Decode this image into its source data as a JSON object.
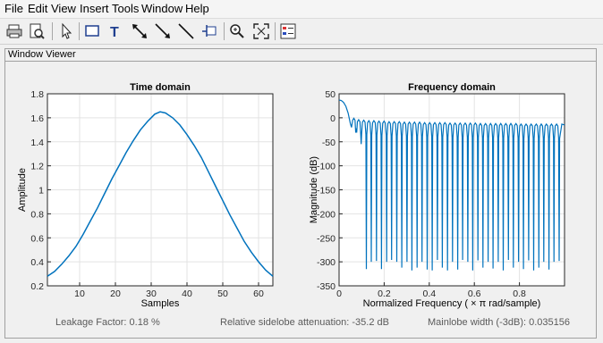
{
  "menu": [
    "File",
    "Edit",
    "View",
    "Insert",
    "Tools",
    "Window",
    "Help"
  ],
  "toolbar": [
    {
      "name": "print-icon"
    },
    {
      "name": "print-preview-icon"
    },
    {
      "name": "edit-plot-arrow-icon"
    },
    {
      "name": "insert-rectangle-icon"
    },
    {
      "name": "insert-text-icon"
    },
    {
      "name": "insert-double-arrow-icon"
    },
    {
      "name": "insert-arrow-icon"
    },
    {
      "name": "insert-line-icon"
    },
    {
      "name": "pin-icon"
    },
    {
      "name": "zoom-in-icon"
    },
    {
      "name": "full-view-icon"
    },
    {
      "name": "legend-icon"
    }
  ],
  "panel": {
    "title": "Window Viewer"
  },
  "stats": {
    "leakage": "Leakage Factor: 0.18 %",
    "sidelobe": "Relative sidelobe attenuation: -35.2 dB",
    "mainlobe": "Mainlobe width (-3dB): 0.035156"
  },
  "colors": {
    "line": "#0072bd",
    "grid": "#e3e3e3"
  },
  "chart_data": [
    {
      "type": "line",
      "title": "Time domain",
      "xlabel": "Samples",
      "ylabel": "Amplitude",
      "xlim": [
        1,
        64
      ],
      "ylim": [
        0.2,
        1.8
      ],
      "xticks": [
        10,
        20,
        30,
        40,
        50,
        60
      ],
      "yticks": [
        0.2,
        0.4,
        0.6,
        0.8,
        1,
        1.2,
        1.4,
        1.6,
        1.8
      ],
      "ytick_labels": [
        "0.2",
        "0.4",
        "0.6",
        "0.8",
        "1",
        "1.2",
        "1.4",
        "1.6",
        "1.8"
      ],
      "grid": true,
      "x": [
        1,
        3,
        5,
        7,
        9,
        11,
        13,
        15,
        17,
        19,
        21,
        23,
        25,
        27,
        29,
        31,
        32.5,
        34,
        36,
        38,
        40,
        42,
        44,
        46,
        48,
        50,
        52,
        54,
        56,
        58,
        60,
        62,
        64
      ],
      "y": [
        0.28,
        0.32,
        0.38,
        0.45,
        0.53,
        0.63,
        0.74,
        0.85,
        0.97,
        1.09,
        1.2,
        1.31,
        1.41,
        1.5,
        1.57,
        1.63,
        1.65,
        1.64,
        1.6,
        1.54,
        1.46,
        1.37,
        1.27,
        1.15,
        1.03,
        0.91,
        0.79,
        0.68,
        0.57,
        0.48,
        0.4,
        0.33,
        0.28
      ]
    },
    {
      "type": "line",
      "title": "Frequency domain",
      "xlabel": "Normalized Frequency  ( × π rad/sample)",
      "ylabel": "Magnitude (dB)",
      "xlim": [
        0,
        1
      ],
      "ylim": [
        -350,
        50
      ],
      "xticks": [
        0,
        0.2,
        0.4,
        0.6,
        0.8
      ],
      "xtick_labels": [
        "0",
        "0.2",
        "0.4",
        "0.6",
        "0.8"
      ],
      "yticks": [
        50,
        0,
        -50,
        -100,
        -150,
        -200,
        -250,
        -300,
        -350
      ],
      "grid": true,
      "mainlobe": {
        "x": [
          0,
          0.01,
          0.02,
          0.03,
          0.04,
          0.05
        ],
        "y": [
          37,
          36,
          32,
          24,
          10,
          -12
        ]
      },
      "first_null": {
        "x": 0.055,
        "y": -20
      },
      "nulls": [
        {
          "x": 0.076,
          "y": -22
        },
        {
          "x": 0.098,
          "y": -55
        },
        {
          "x": 0.121,
          "y": -315
        },
        {
          "x": 0.143,
          "y": -300
        },
        {
          "x": 0.166,
          "y": -298
        },
        {
          "x": 0.188,
          "y": -315
        },
        {
          "x": 0.211,
          "y": -300
        },
        {
          "x": 0.233,
          "y": -296
        },
        {
          "x": 0.256,
          "y": -300
        },
        {
          "x": 0.278,
          "y": -312
        },
        {
          "x": 0.301,
          "y": -300
        },
        {
          "x": 0.323,
          "y": -318
        },
        {
          "x": 0.346,
          "y": -312
        },
        {
          "x": 0.368,
          "y": -300
        },
        {
          "x": 0.391,
          "y": -316
        },
        {
          "x": 0.413,
          "y": -318
        },
        {
          "x": 0.436,
          "y": -296
        },
        {
          "x": 0.458,
          "y": -312
        },
        {
          "x": 0.481,
          "y": -318
        },
        {
          "x": 0.503,
          "y": -300
        },
        {
          "x": 0.526,
          "y": -316
        },
        {
          "x": 0.548,
          "y": -296
        },
        {
          "x": 0.571,
          "y": -300
        },
        {
          "x": 0.593,
          "y": -318
        },
        {
          "x": 0.616,
          "y": -297
        },
        {
          "x": 0.638,
          "y": -312
        },
        {
          "x": 0.661,
          "y": -300
        },
        {
          "x": 0.683,
          "y": -314
        },
        {
          "x": 0.706,
          "y": -300
        },
        {
          "x": 0.728,
          "y": -318
        },
        {
          "x": 0.751,
          "y": -296
        },
        {
          "x": 0.773,
          "y": -312
        },
        {
          "x": 0.796,
          "y": -300
        },
        {
          "x": 0.818,
          "y": -315
        },
        {
          "x": 0.841,
          "y": -297
        },
        {
          "x": 0.863,
          "y": -318
        },
        {
          "x": 0.886,
          "y": -312
        },
        {
          "x": 0.908,
          "y": -300
        },
        {
          "x": 0.931,
          "y": -316
        },
        {
          "x": 0.953,
          "y": -300
        },
        {
          "x": 0.976,
          "y": -298
        }
      ],
      "sidelobe_peaks": [
        -1,
        -4,
        -5,
        -6,
        -6,
        -7,
        -7,
        -8,
        -8,
        -8,
        -9,
        -9,
        -9,
        -9,
        -10,
        -10,
        -10,
        -10,
        -10,
        -11,
        -11,
        -11,
        -11,
        -11,
        -11,
        -12,
        -12,
        -12,
        -12,
        -12,
        -12,
        -12,
        -12,
        -13,
        -13,
        -13,
        -13,
        -13,
        -13,
        -13,
        -13,
        -13
      ]
    }
  ]
}
